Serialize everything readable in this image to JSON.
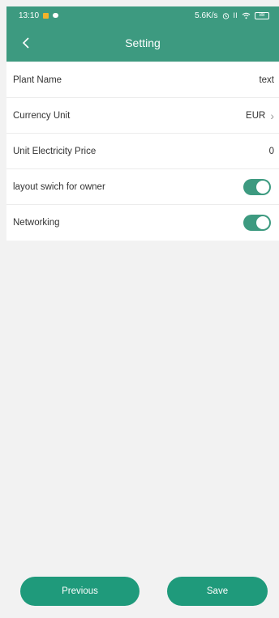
{
  "status_bar": {
    "time": "13:10",
    "network_speed": "5.6K/s",
    "signal": "Il",
    "battery": "88"
  },
  "header": {
    "title": "Setting",
    "back_icon": "chevron-left-icon"
  },
  "settings": {
    "plant_name": {
      "label": "Plant Name",
      "value": "text"
    },
    "currency_unit": {
      "label": "Currency Unit",
      "value": "EUR"
    },
    "unit_electricity_price": {
      "label": "Unit Electricity Price",
      "value": "0"
    },
    "layout_switch": {
      "label": "layout swich for owner",
      "enabled": true
    },
    "networking": {
      "label": "Networking",
      "enabled": true
    }
  },
  "footer": {
    "previous_label": "Previous",
    "save_label": "Save"
  },
  "colors": {
    "primary": "#3d9a80",
    "button": "#1f9a7b",
    "background": "#f2f2f2"
  }
}
